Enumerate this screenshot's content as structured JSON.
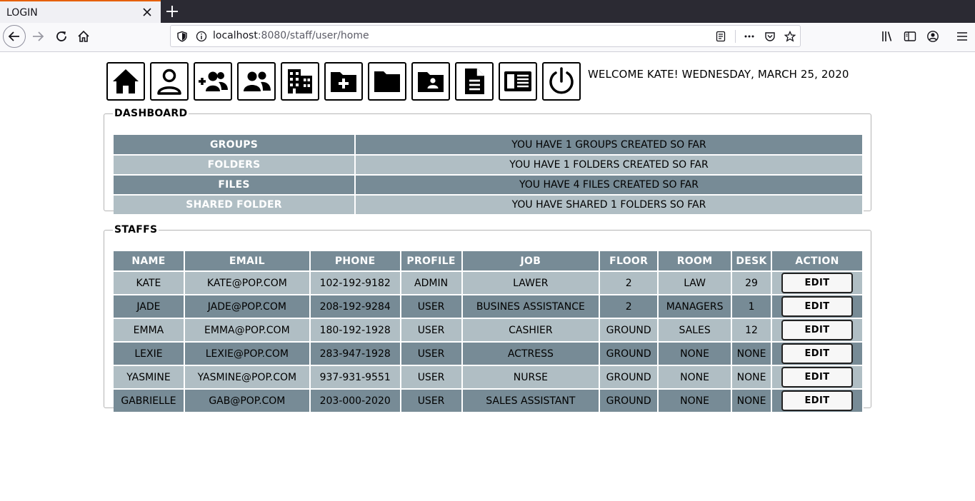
{
  "browser": {
    "tab_title": "LOGIN",
    "url_host": "localhost",
    "url_path": ":8080/staff/user/home"
  },
  "header": {
    "icons": [
      "home-icon",
      "user-icon",
      "add-group-icon",
      "group-icon",
      "building-icon",
      "add-folder-icon",
      "folder-icon",
      "shared-folder-icon",
      "document-icon",
      "newspaper-icon",
      "power-icon"
    ],
    "welcome": "WELCOME KATE! WEDNESDAY, MARCH 25, 2020"
  },
  "dashboard": {
    "legend": "DASHBOARD",
    "rows": [
      {
        "label": "GROUPS",
        "value": "YOU HAVE 1 GROUPS CREATED SO FAR"
      },
      {
        "label": "FOLDERS",
        "value": "YOU HAVE 1 FOLDERS CREATED SO FAR"
      },
      {
        "label": "FILES",
        "value": "YOU HAVE 4 FILES CREATED SO FAR"
      },
      {
        "label": "SHARED FOLDER",
        "value": "YOU HAVE SHARED 1 FOLDERS SO FAR"
      }
    ]
  },
  "staffs": {
    "legend": "STAFFS",
    "columns": [
      "NAME",
      "EMAIL",
      "PHONE",
      "PROFILE",
      "JOB",
      "FLOOR",
      "ROOM",
      "DESK",
      "ACTION"
    ],
    "edit_label": "EDIT",
    "rows": [
      [
        "KATE",
        "KATE@POP.COM",
        "102-192-9182",
        "ADMIN",
        "LAWER",
        "2",
        "LAW",
        "29"
      ],
      [
        "JADE",
        "JADE@POP.COM",
        "208-192-9284",
        "USER",
        "BUSINES ASSISTANCE",
        "2",
        "MANAGERS",
        "1"
      ],
      [
        "EMMA",
        "EMMA@POP.COM",
        "180-192-1928",
        "USER",
        "CASHIER",
        "GROUND",
        "SALES",
        "12"
      ],
      [
        "LEXIE",
        "LEXIE@POP.COM",
        "283-947-1928",
        "USER",
        "ACTRESS",
        "GROUND",
        "NONE",
        "NONE"
      ],
      [
        "YASMINE",
        "YASMINE@POP.COM",
        "937-931-9551",
        "USER",
        "NURSE",
        "GROUND",
        "NONE",
        "NONE"
      ],
      [
        "GABRIELLE",
        "GAB@POP.COM",
        "203-000-2020",
        "USER",
        "SALES ASSISTANT",
        "GROUND",
        "NONE",
        "NONE"
      ]
    ]
  },
  "colors": {
    "dark_row": "#778b96",
    "light_row": "#b0bec4"
  }
}
